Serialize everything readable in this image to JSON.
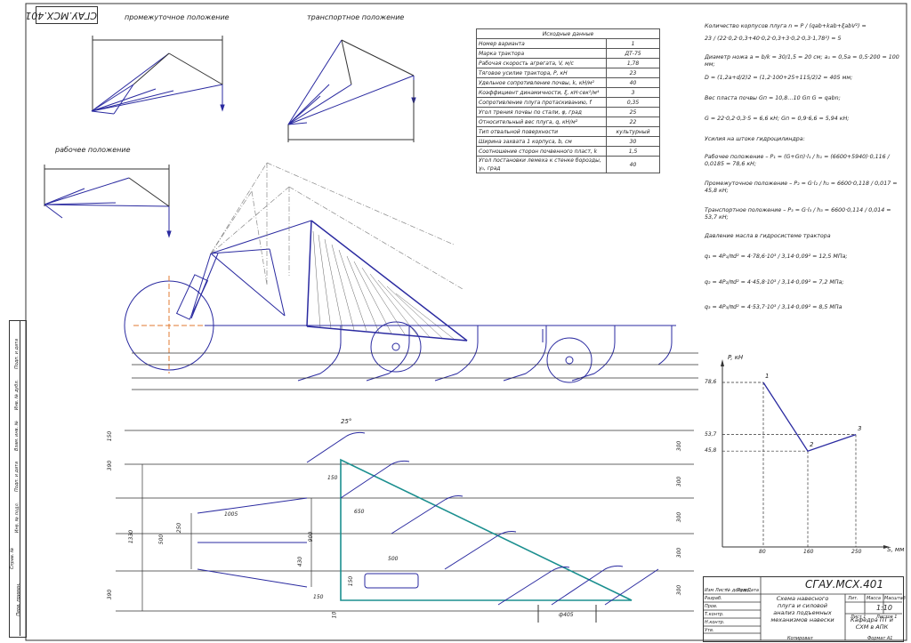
{
  "stamp_code": "СГАУ.МСХ.401",
  "views": {
    "intermediate_label": "промежуточное положение",
    "transport_label": "транспортное положение",
    "working_label": "рабочее положение"
  },
  "source_table": {
    "header": "Исходные данные",
    "rows": [
      {
        "label": "Номер варианта",
        "value": "1"
      },
      {
        "label": "Марка трактора",
        "value": "ДТ-75"
      },
      {
        "label": "Рабочая скорость агрегата, V, м/с",
        "value": "1,78"
      },
      {
        "label": "Тяговое усилие трактора, Р, кН",
        "value": "23"
      },
      {
        "label": "Удельное сопротивление почвы, k, кН/м²",
        "value": "40"
      },
      {
        "label": "Коэффициент динамичности, ξ, кН·сек²/м⁴",
        "value": "3"
      },
      {
        "label": "Сопротивление плуга протаскиванию, f",
        "value": "0,35"
      },
      {
        "label": "Угол трения почвы по стали, φ, град",
        "value": "25"
      },
      {
        "label": "Относительный вес плуга, q, кН/м²",
        "value": "22"
      },
      {
        "label": "Тип отвальной поверхности",
        "value": "культурный"
      },
      {
        "label": "Ширина захвата 1 корпуса, b, см",
        "value": "30"
      },
      {
        "label": "Соотношение сторон почвенного пласт, k",
        "value": "1,5"
      },
      {
        "label": "Угол постановки лемеха к стенке борозды, γ₀, град",
        "value": "40"
      }
    ]
  },
  "formulas": [
    "Количество корпусов плуга n = P / (qab+kab+ξabV²) =",
    "23 / (22·0,2·0,3+40·0,2·0,3+3·0,2·0,3·1,78²) = 5",
    "Диаметр ножа a = b/k = 30/1,5 = 20 см;  a₁ = 0,5a = 0,5·200 = 100 мм;",
    "D = (1,2a+d/2)2 = (1,2·100+25+115/2)2 = 405 мм;",
    "Вес пласта почвы Gп = 10,8…10 Gп  G = qabn;",
    "G = 22·0,2·0,3·5 = 6,6 кН;  Gп = 0,9·6,6 = 5,94 кН;",
    "Усилия на штоке гидроцилиндра:",
    "Рабочее положение – P₁ = (G+Gп)·l₁ / h₁ = (6600+5940)·0,116 / 0,0185 = 78,6 кН;",
    "Промежуточное положение – P₂ = G·l₂ / h₂ = 6600·0,118 / 0,017 = 45,8 кН;",
    "Транспортное положение – P₃ = G·l₃ / h₃ = 6600·0,114 / 0,014 = 53,7 кН;",
    "Давление масла в гидросистеме трактора",
    "q₁ = 4P₁/πd² = 4·78,6·10³ / 3,14·0,09² = 12,5 МПа;",
    "q₂ = 4P₂/πd² = 4·45,8·10³ / 3,14·0,09² = 7,2 МПа;",
    "q₃ = 4P₃/πd² = 4·53,7·10³ / 3,14·0,09² = 8,5 МПа"
  ],
  "graph": {
    "ylabel": "P, кН",
    "xlabel": "S, мм",
    "y_ticks": [
      "78,6",
      "53,7",
      "45,8"
    ],
    "x_ticks": [
      "80",
      "160",
      "250"
    ],
    "points": [
      {
        "label": "1",
        "s": 80,
        "p": 78.6
      },
      {
        "label": "2",
        "s": 160,
        "p": 45.8
      },
      {
        "label": "3",
        "s": 250,
        "p": 53.7
      }
    ],
    "colors": {
      "line": "#2a2aa0",
      "dash": "#333333"
    }
  },
  "dimensions": {
    "angle": "25°",
    "d150a": "150",
    "d390a": "390",
    "d1330": "1330",
    "d390b": "390",
    "d300_1": "300",
    "d300_2": "300",
    "d300_3": "300",
    "d300_4": "300",
    "d300_5": "300",
    "d150b": "150",
    "d650": "650",
    "d1005": "1005",
    "d250": "250",
    "d500a": "500",
    "d900": "900",
    "d430": "430",
    "d150c": "150",
    "d500b": "500",
    "d150d": "150",
    "d10": "10",
    "dia": "ф405"
  },
  "title_block": {
    "code": "СГАУ.МСХ.401",
    "name": "Схема навесного плуга и силовой анализ подъемных механизмов навески",
    "scale": "1:10",
    "dept": "Кафедра ПТ и СХМ в АПК",
    "lit": "Лит.",
    "mass": "Масса",
    "scale_hdr": "Масштаб",
    "sheet": "Лист 1",
    "sheets": "Листов 1",
    "copied": "Копировал",
    "format": "Формат А1",
    "rows": [
      "Изм",
      "Лист",
      "№ докум.",
      "Подп.",
      "Дата",
      "Разраб.",
      "Пров.",
      "Т.контр.",
      "Н.контр.",
      "Утв."
    ]
  },
  "side_stamps": [
    "Подп. и дата",
    "Инв. № дубл.",
    "Взам. инв. №",
    "Подп. и дата",
    "Инв. № подл.",
    "Справ. №",
    "Перв. примен."
  ]
}
